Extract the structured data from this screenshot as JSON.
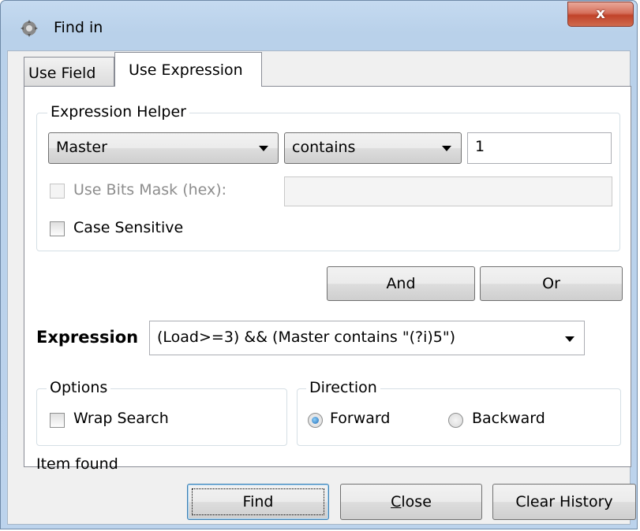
{
  "window": {
    "title": "Find in",
    "close_glyph": "x",
    "icon": "app-icon"
  },
  "tabs": [
    {
      "label": "Use Field",
      "active": false
    },
    {
      "label": "Use Expression",
      "active": true
    }
  ],
  "expression_helper": {
    "group_label": "Expression Helper",
    "field_value": "Master",
    "operator_value": "contains",
    "value_text": "1",
    "bits_mask_label": "Use Bits Mask (hex):",
    "bits_mask_enabled": false,
    "bits_mask_value": "",
    "case_sensitive_label": "Case Sensitive",
    "case_sensitive_checked": false
  },
  "combine_buttons": {
    "and_label": "And",
    "or_label": "Or"
  },
  "expression": {
    "label": "Expression",
    "value": "(Load>=3) && (Master contains \"(?i)5\")"
  },
  "options": {
    "group_label": "Options",
    "wrap_search_label": "Wrap Search",
    "wrap_search_checked": false
  },
  "direction": {
    "group_label": "Direction",
    "forward_label": "Forward",
    "backward_label": "Backward",
    "selected": "Forward"
  },
  "status": "Item found",
  "footer": {
    "find_label": "Find",
    "close_label_prefix": "C",
    "close_label_rest": "lose",
    "clear_history_label": "Clear History"
  },
  "colors": {
    "title_gradient_top": "#c5daf0",
    "close_button_red": "#c1432a",
    "radio_selected": "#1e6bb8"
  }
}
